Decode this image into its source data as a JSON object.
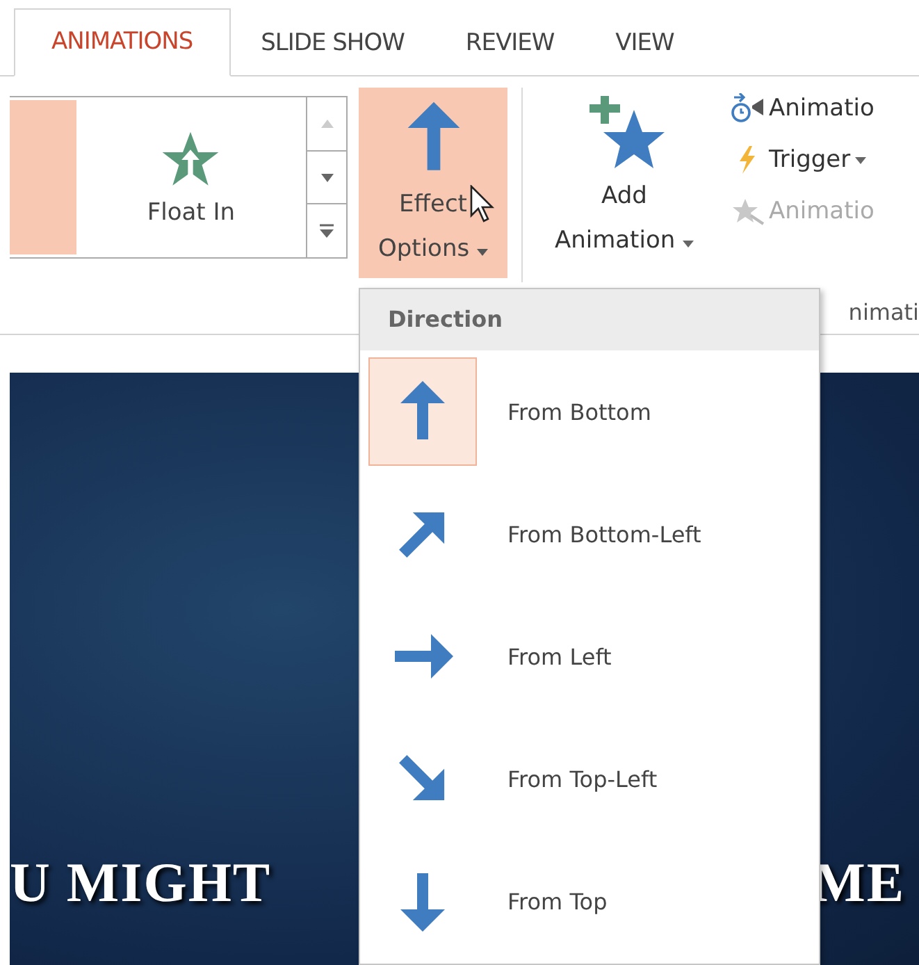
{
  "tabs": [
    {
      "label": "ANIMATIONS",
      "selected": true
    },
    {
      "label": "SLIDE SHOW",
      "selected": false
    },
    {
      "label": "REVIEW",
      "selected": false
    },
    {
      "label": "VIEW",
      "selected": false
    }
  ],
  "ribbon": {
    "gallery": {
      "items": [
        {
          "kind": "partial",
          "selected": true
        },
        {
          "kind": "float-in",
          "label": "Float In",
          "selected": false
        }
      ]
    },
    "effect_options": {
      "label": "Effect Options",
      "pressed": true
    },
    "add_animation": {
      "label": "Add Animation"
    },
    "side_commands": [
      {
        "kind": "pane",
        "label": "Animatio",
        "disabled": false,
        "dropdown": false
      },
      {
        "kind": "trigger",
        "label": "Trigger",
        "disabled": false,
        "dropdown": true
      },
      {
        "kind": "painter",
        "label": "Animatio",
        "disabled": true,
        "dropdown": false
      }
    ],
    "group_label": "nimati"
  },
  "menu": {
    "header": "Direction",
    "items": [
      {
        "kind": "up",
        "label": "From Bottom",
        "selected": true
      },
      {
        "kind": "up-right",
        "label": "From Bottom-Left",
        "selected": false
      },
      {
        "kind": "right",
        "label": "From Left",
        "selected": false
      },
      {
        "kind": "down-right",
        "label": "From Top-Left",
        "selected": false
      },
      {
        "kind": "down",
        "label": "From Top",
        "selected": false
      }
    ]
  },
  "slide": {
    "title_parts": [
      "U MIGHT",
      "ME"
    ]
  }
}
